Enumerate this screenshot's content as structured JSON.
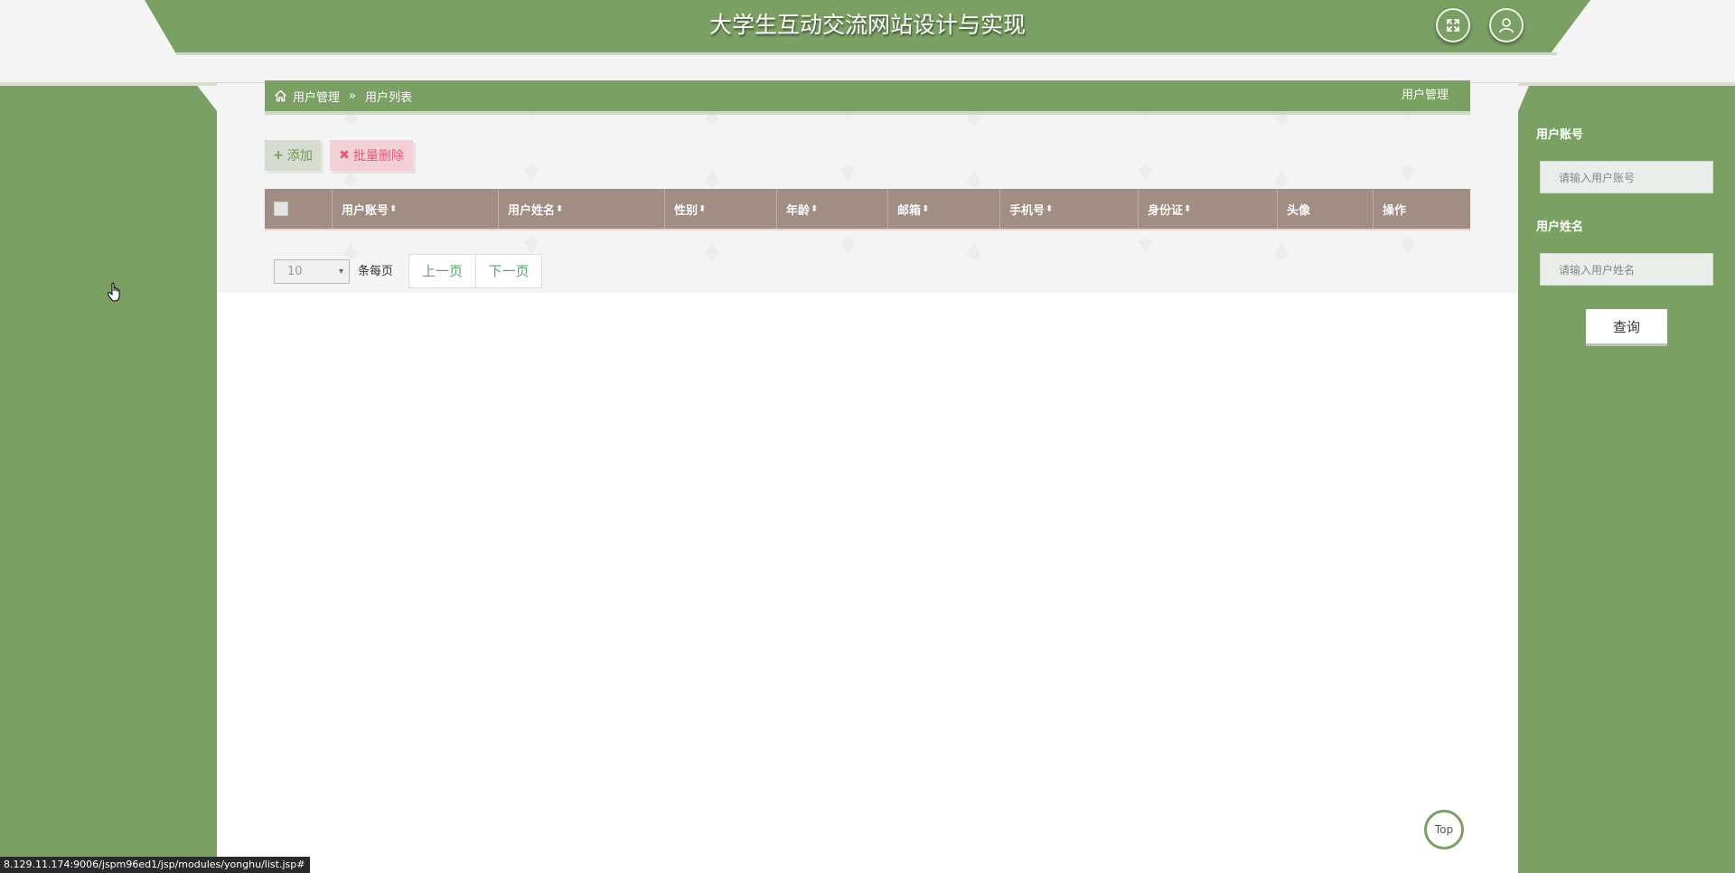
{
  "header": {
    "title": "大学生互动交流网站设计与实现",
    "fullscreen_icon": "fullscreen-icon",
    "user_icon": "user-icon"
  },
  "breadcrumb": {
    "home_icon": "home-icon",
    "module": "用户管理",
    "separator": "»",
    "page": "用户列表",
    "right_title": "用户管理"
  },
  "actions": {
    "add_label": "添加",
    "batch_delete_label": "批量删除"
  },
  "table": {
    "columns": [
      "",
      "用户账号",
      "用户姓名",
      "性别",
      "年龄",
      "邮箱",
      "手机号",
      "身份证",
      "头像",
      "操作"
    ],
    "sortable": [
      false,
      true,
      true,
      true,
      true,
      true,
      true,
      true,
      false,
      false
    ],
    "rows": []
  },
  "pager": {
    "page_size": "10",
    "page_size_suffix": "条每页",
    "prev_label": "上一页",
    "next_label": "下一页"
  },
  "search": {
    "account_label": "用户账号",
    "account_placeholder": "请输入用户账号",
    "name_label": "用户姓名",
    "name_placeholder": "请输入用户姓名",
    "query_label": "查询"
  },
  "back_to_top": "Top",
  "status_bar_url": "8.129.11.174:9006/jspm96ed1/jsp/modules/yonghu/list.jsp#",
  "colors": {
    "brand_green": "#7aa063",
    "table_header": "#a18d84",
    "add_text": "#6e9a56",
    "delete_text": "#e05b7a",
    "pager_link": "#5aa66d"
  }
}
